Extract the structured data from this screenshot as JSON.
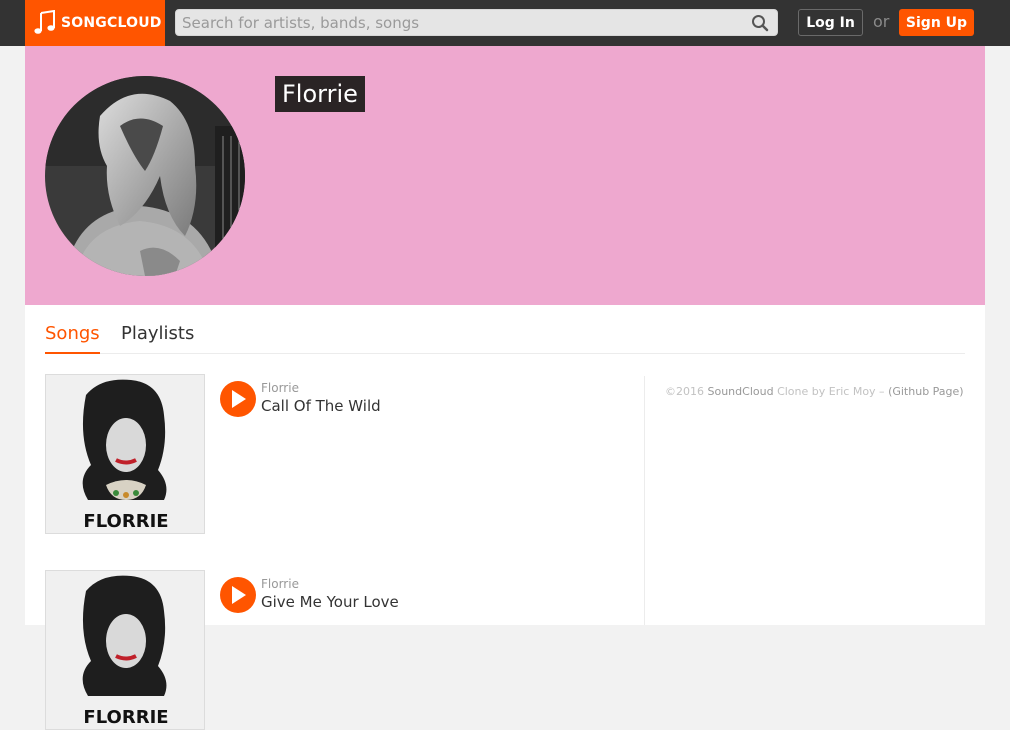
{
  "header": {
    "logo_text": "SONGCLOUD",
    "search_placeholder": "Search for artists, bands, songs",
    "login_label": "Log In",
    "or_text": "or",
    "signup_label": "Sign Up"
  },
  "colors": {
    "brand": "#ff5500",
    "topbar": "#333333",
    "hero": "#eea8cf"
  },
  "profile": {
    "name": "Florrie"
  },
  "tabs": [
    {
      "label": "Songs",
      "active": true
    },
    {
      "label": "Playlists",
      "active": false
    }
  ],
  "songs": [
    {
      "artist": "Florrie",
      "title": "Call Of The Wild",
      "cover_text": "FLORRIE"
    },
    {
      "artist": "Florrie",
      "title": "Give Me Your Love",
      "cover_text": "FLORRIE"
    }
  ],
  "footer": {
    "year": "©2016",
    "brand": "SoundCloud",
    "clone_text": "Clone by Eric Moy –",
    "github": "(Github Page)"
  }
}
